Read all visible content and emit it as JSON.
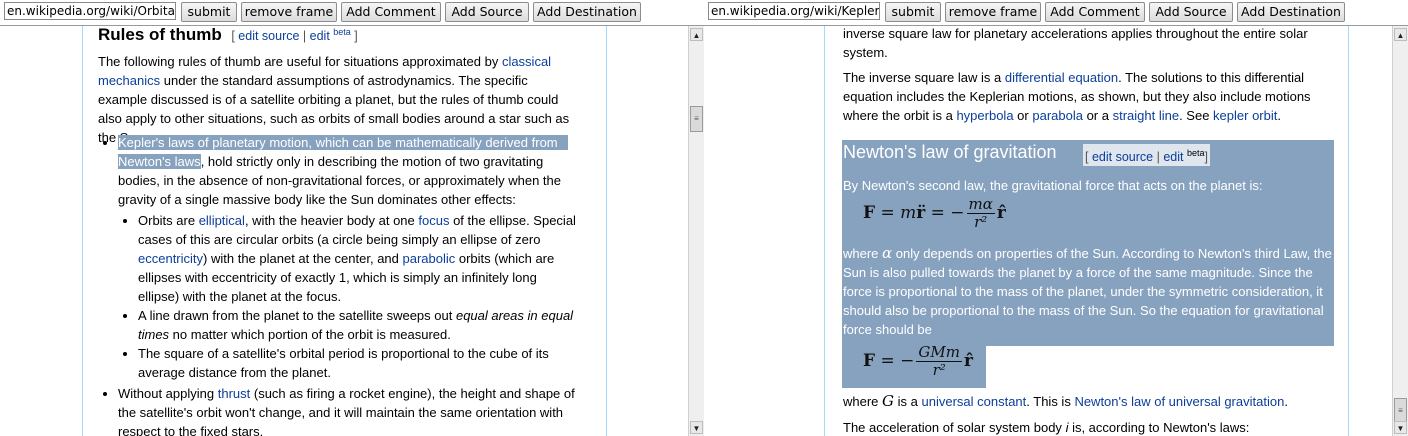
{
  "left": {
    "url": "en.wikipedia.org/wiki/Orbital_",
    "buttons": {
      "submit": "submit",
      "remove_frame": "remove frame",
      "add_comment": "Add Comment",
      "add_source": "Add Source",
      "add_destination": "Add Destination"
    },
    "heading": "Rules of thumb",
    "edit_source": "edit source",
    "edit": "edit",
    "beta": "beta",
    "intro": {
      "t1": "The following rules of thumb are useful for situations approximated by ",
      "l1": "classical mechanics",
      "t2": " under the standard assumptions of astrodynamics. The specific example discussed is of a satellite orbiting a planet, but the rules of thumb could also apply to other situations, such as orbits of small bodies around a star such as the Sun."
    },
    "b1": {
      "sel1": "Kepler's laws of planetary motion, which can be mathematically derived from",
      "sel2": "Newton's laws",
      "t": ", hold strictly only in describing the motion of two gravitating bodies, in the absence of non-gravitational forces, or approximately when the gravity of a single massive body like the Sun dominates other effects:"
    },
    "s1": {
      "t1": "Orbits are ",
      "l1": "elliptical",
      "t2": ", with the heavier body at one ",
      "l2": "focus",
      "t3": " of the ellipse. Special cases of this are circular orbits (a circle being simply an ellipse of zero ",
      "l3": "eccentricity",
      "t4": ") with the planet at the center, and ",
      "l4": "parabolic",
      "t5": " orbits (which are ellipses with eccentricity of exactly 1, which is simply an infinitely long ellipse) with the planet at the focus."
    },
    "s2": {
      "t1": "A line drawn from the planet to the satellite sweeps out ",
      "i1": "equal areas in equal times",
      "t2": " no matter which portion of the orbit is measured."
    },
    "s3": "The square of a satellite's orbital period is proportional to the cube of its average distance from the planet.",
    "b2": {
      "t1": "Without applying ",
      "l1": "thrust",
      "t2": " (such as firing a rocket engine), the height and shape of the satellite's orbit won't change, and it will maintain the same orientation with respect to the fixed stars."
    }
  },
  "right": {
    "url": "en.wikipedia.org/wiki/Kepler's",
    "buttons": {
      "submit": "submit",
      "remove_frame": "remove frame",
      "add_comment": "Add Comment",
      "add_source": "Add Source",
      "add_destination": "Add Destination"
    },
    "p0": "inverse square law for planetary accelerations applies throughout the entire solar system.",
    "p1": {
      "t1": "The inverse square law is a ",
      "l1": "differential equation",
      "t2": ". The solutions to this differential equation includes the Keplerian motions, as shown, but they also include motions where the orbit is a ",
      "l2": "hyperbola",
      "t3": " or ",
      "l3": "parabola",
      "t4": " or a ",
      "l4": "straight line",
      "t5": ". See ",
      "l5": "kepler orbit",
      "t6": "."
    },
    "heading": "Newton's law of gravitation",
    "edit_source": "edit source",
    "edit": "edit",
    "beta": "beta",
    "p2": "By Newton's second law, the gravitational force that acts on the planet is:",
    "f1": {
      "lhs": "F = m",
      "rdd": "r̈",
      "eq": "= −",
      "num": "mα",
      "den": "r²",
      "rhat": "r̂"
    },
    "p3": {
      "t1": "where ",
      "alpha": "α",
      "t2": " only depends on properties of the Sun. According to Newton's third Law, the Sun is also pulled towards the planet by a force of the same magnitude. Since the force is proportional to the mass of the planet, under the symmetric consideration, it should also be proportional to the mass of the Sun. So the equation for gravitational force should be"
    },
    "f2": {
      "lhs": "F = −",
      "num": "GMm",
      "den": "r²",
      "rhat": "r̂"
    },
    "p4": {
      "t1": "where ",
      "g": "G",
      "t2": " is a ",
      "l1": "universal constant",
      "t3": ". This is ",
      "l2": "Newton's law of universal gravitation",
      "t4": "."
    },
    "p5": {
      "t1": "The acceleration of solar system body ",
      "i": "i",
      "t2": " is, according to Newton's laws:"
    }
  }
}
